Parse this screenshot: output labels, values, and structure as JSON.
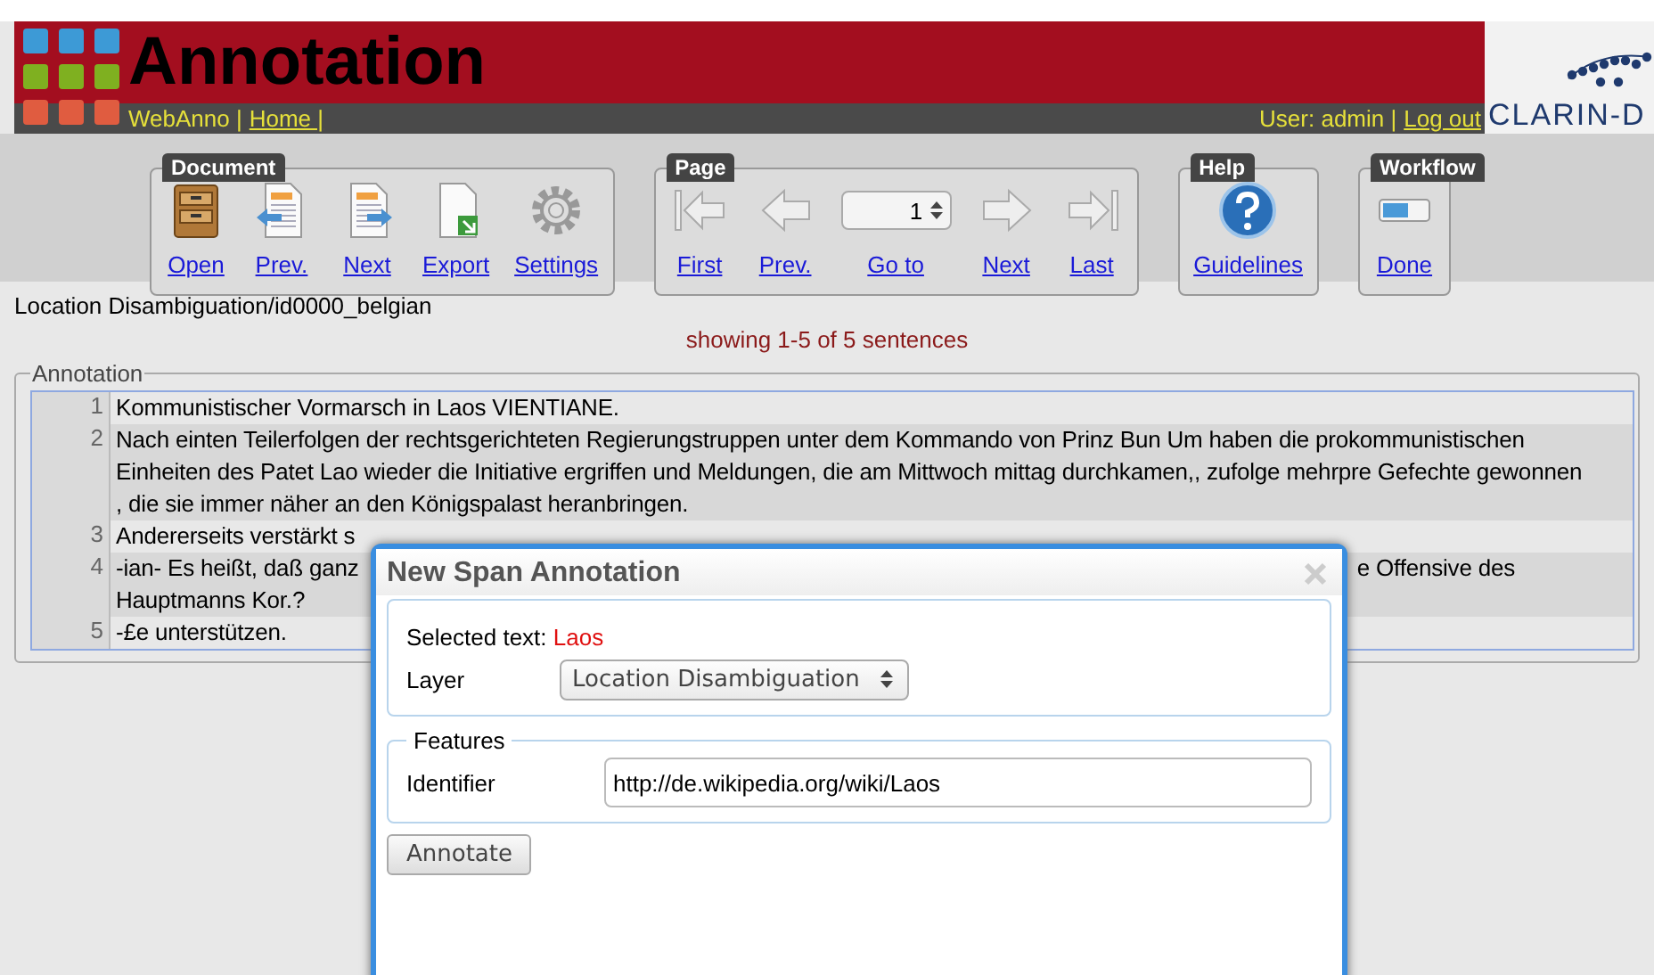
{
  "header": {
    "title": "Annotation",
    "app_link": "WebAnno |",
    "home_link": "Home |",
    "user": "User: admin |",
    "logout": "Log out",
    "logo_text": "CLARIN-D"
  },
  "toolbar": [
    {
      "label": "Document",
      "buttons": [
        {
          "label": "Open"
        },
        {
          "label": "Prev."
        },
        {
          "label": "Next"
        },
        {
          "label": "Export"
        },
        {
          "label": "Settings"
        }
      ]
    },
    {
      "label": "Page",
      "buttons": [
        {
          "label": "First"
        },
        {
          "label": "Prev."
        },
        {
          "label": "Go to",
          "value": "1"
        },
        {
          "label": "Next"
        },
        {
          "label": "Last"
        }
      ]
    },
    {
      "label": "Help",
      "buttons": [
        {
          "label": "Guidelines"
        }
      ]
    },
    {
      "label": "Workflow",
      "buttons": [
        {
          "label": "Done"
        }
      ]
    }
  ],
  "document_path": "Location Disambiguation/id0000_belgian",
  "showing": "showing 1-5 of 5 sentences",
  "annotation_panel": {
    "legend": "Annotation",
    "sentences": [
      {
        "number": "1",
        "lines": [
          [
            "Kommunistischer Vormarsch in Laos VIENTIANE."
          ]
        ]
      },
      {
        "number": "2",
        "lines": [
          [
            "Nach einten Teilerfolgen der rechtsgerichteten Regierungstruppen unter dem Kommando von Prinz Bun Um haben die prokommunistischen"
          ],
          [
            "Einheiten des Patet Lao wieder die Initiative ergriffen und Meldungen, die am Mittwoch mittag durchkamen,, zufolge mehrpre Gefechte gewonnen"
          ],
          [
            ", die sie immer näher an den Königspalast heranbringen."
          ]
        ]
      },
      {
        "number": "3",
        "lines": [
          [
            "Andererseits verstärkt s"
          ]
        ]
      },
      {
        "number": "4",
        "lines": [
          [
            "-ian- Es heißt, daß ganz",
            "e Offensive des"
          ],
          [
            "Hauptmanns Kor.?"
          ]
        ]
      },
      {
        "number": "5",
        "lines": [
          [
            "-£e unterstützen."
          ]
        ]
      }
    ]
  },
  "dialog": {
    "title": "New Span Annotation",
    "selected_label": "Selected text:",
    "selected_text": "Laos",
    "layer_label": "Layer",
    "layer_value": "Location Disambiguation",
    "features_legend": "Features",
    "identifier_label": "Identifier",
    "identifier_value": "http://de.wikipedia.org/wiki/Laos",
    "button": "Annotate"
  }
}
